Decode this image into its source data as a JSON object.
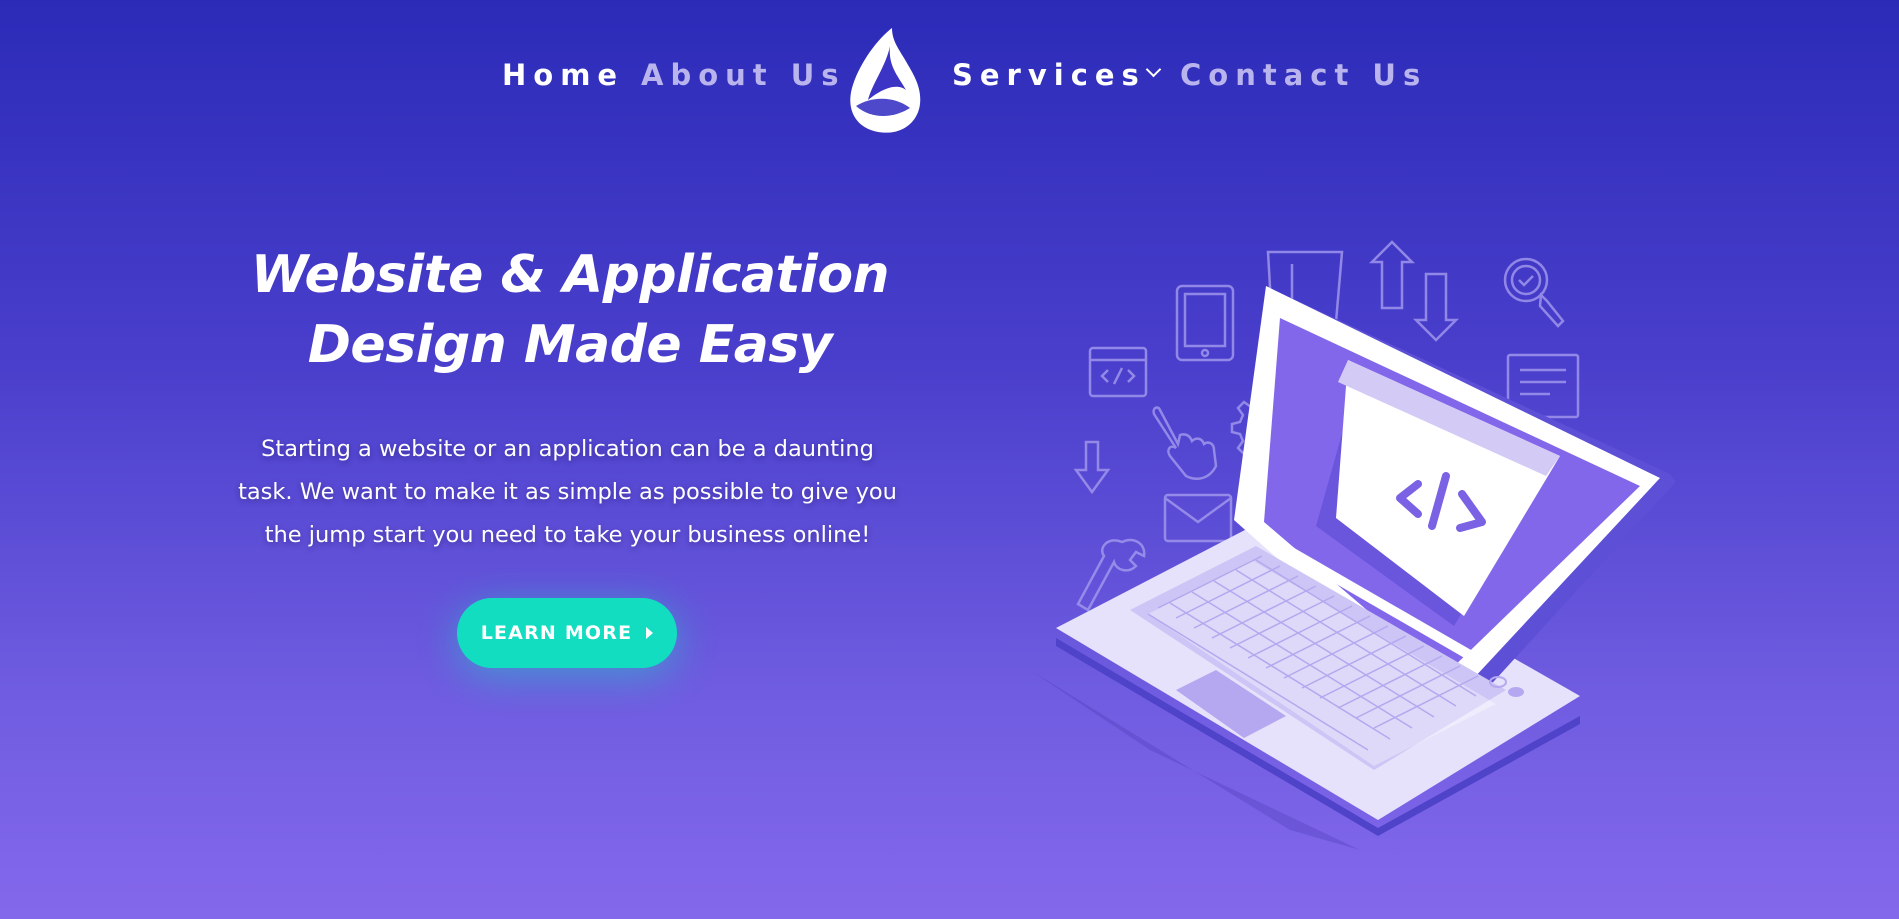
{
  "nav": {
    "home": "Home",
    "about": "About Us",
    "services": "Services",
    "contact": "Contact Us"
  },
  "hero": {
    "title_line1": "Website & Application",
    "title_line2": "Design Made Easy",
    "description_line1": "Starting a website or an application can be a daunting",
    "description_line2": "task. We want to make it as simple as possible to give you",
    "description_line3": "the jump start you need to take your business online!",
    "cta_label": "LEARN MORE"
  },
  "colors": {
    "background_top": "#2b2bb8",
    "background_bottom": "#8468ec",
    "cta": "#13ddc1",
    "nav_active": "#ffffff",
    "nav_inactive": "#b9b4ee",
    "laptop_screen": "#8367ea",
    "laptop_body": "#e6e2fb"
  },
  "icons": [
    "flame-logo-icon",
    "chevron-down-icon",
    "caret-right-icon",
    "laptop-illustration",
    "code-window-icon",
    "tablet-icon",
    "shield-icon",
    "arrows-updown-icon",
    "search-check-icon",
    "document-icon",
    "pointer-hand-icon",
    "gear-icon",
    "arrow-down-icon",
    "envelope-icon",
    "wrench-icon"
  ]
}
